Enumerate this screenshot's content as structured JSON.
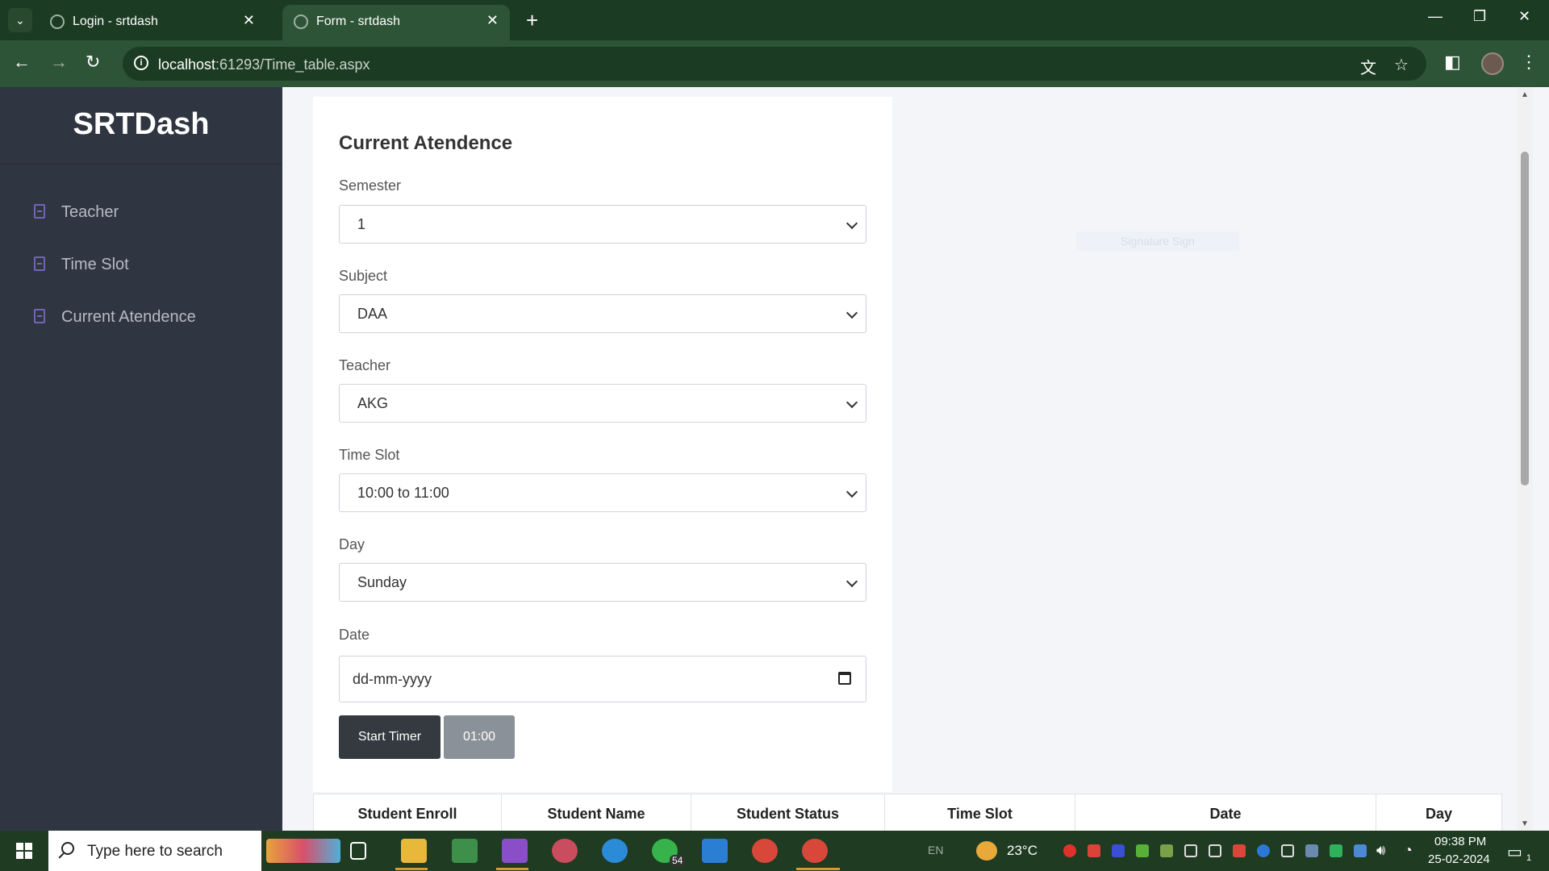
{
  "browser": {
    "tabs": [
      {
        "title": "Login - srtdash",
        "active": false
      },
      {
        "title": "Form - srtdash",
        "active": true
      }
    ],
    "new_tab_icon": "+",
    "url_host": "localhost",
    "url_path": ":61293/Time_table.aspx"
  },
  "sidebar": {
    "brand": "SRTDash",
    "items": [
      {
        "label": "Teacher"
      },
      {
        "label": "Time Slot"
      },
      {
        "label": "Current Atendence"
      }
    ]
  },
  "form": {
    "title": "Current Atendence",
    "semester": {
      "label": "Semester",
      "value": "1"
    },
    "subject": {
      "label": "Subject",
      "value": "DAA"
    },
    "teacher": {
      "label": "Teacher",
      "value": "AKG"
    },
    "time_slot": {
      "label": "Time Slot",
      "value": "10:00 to 11:00"
    },
    "day": {
      "label": "Day",
      "value": "Sunday"
    },
    "date": {
      "label": "Date",
      "placeholder": "dd-mm-yyyy"
    },
    "start_timer_label": "Start Timer",
    "timer_value": "01:00"
  },
  "faint_button_label": "Signature Sign",
  "table": {
    "headers": [
      "Student Enroll",
      "Student Name",
      "Student Status",
      "Time Slot",
      "Date",
      "Day"
    ]
  },
  "taskbar": {
    "search_placeholder": "Type here to search",
    "whatsapp_badge": "54",
    "language": "EN",
    "temperature": "23°C",
    "time": "09:38 PM",
    "date": "25-02-2024",
    "notification_count": "1"
  },
  "colors": {
    "chrome_dark": "#1c3b23",
    "chrome_bar": "#2d5436",
    "sidebar_bg": "#303641",
    "sidebar_icon": "#6f65b8",
    "button_dark": "#343a40",
    "timer_grey": "#8a9199"
  }
}
